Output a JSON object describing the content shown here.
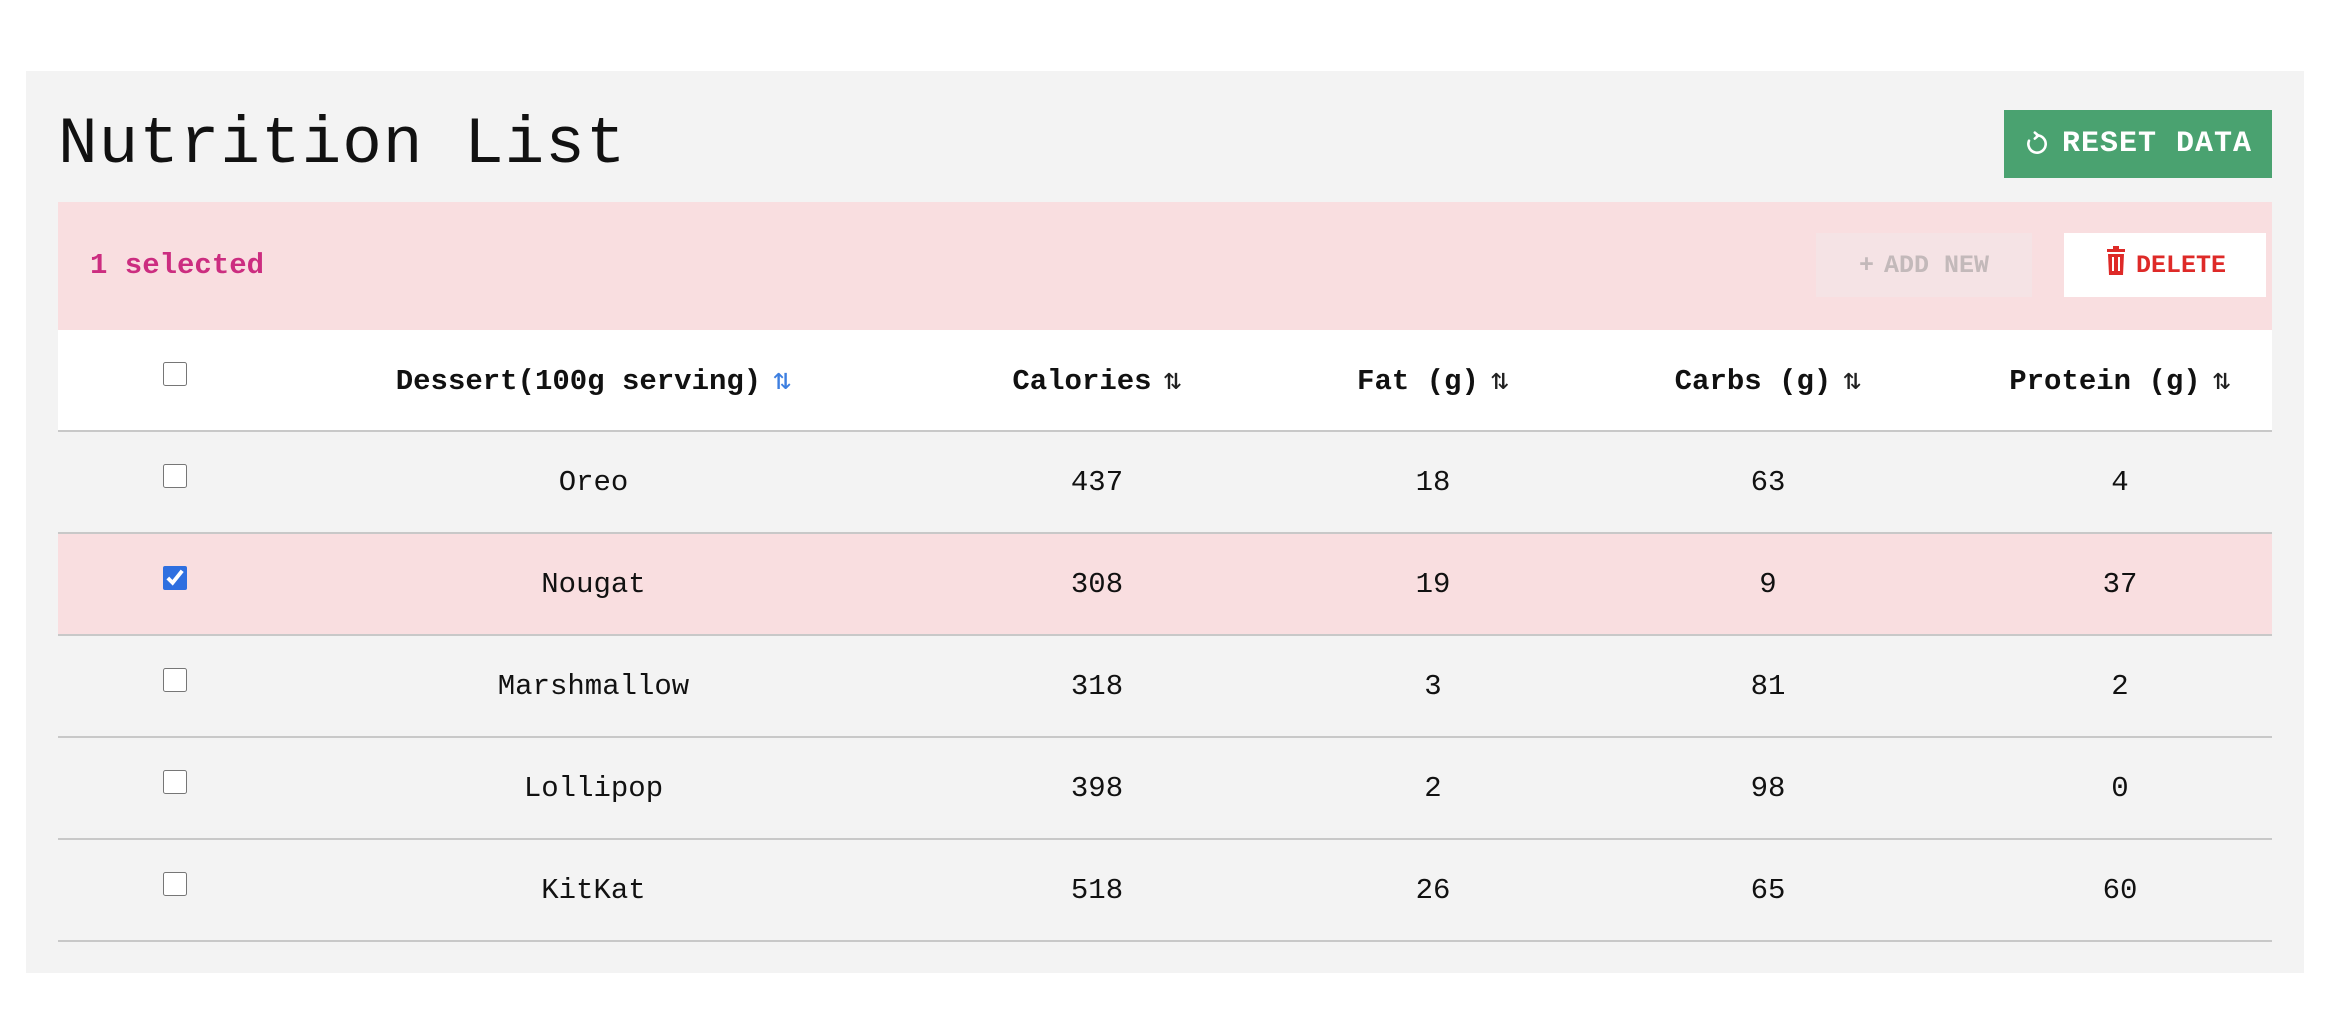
{
  "page": {
    "title": "Nutrition List"
  },
  "toolbar": {
    "reset_label": "RESET DATA",
    "reset_icon": "refresh-icon",
    "selected_count_text": "1 selected",
    "add_label": "ADD NEW",
    "add_icon": "plus-icon",
    "delete_label": "DELETE",
    "delete_icon": "trash-icon"
  },
  "colors": {
    "reset_button": "#4aa270",
    "selection_bar": "#f9dee0",
    "selected_text": "#cc2d80",
    "delete_text": "#de2a28",
    "active_sort": "#3d7fe0"
  },
  "table": {
    "columns": [
      {
        "label": "Dessert(100g serving)",
        "sort_icon": "sort-arrows-icon",
        "active": true
      },
      {
        "label": "Calories",
        "sort_icon": "sort-arrows-icon",
        "active": false
      },
      {
        "label": "Fat (g)",
        "sort_icon": "sort-arrows-icon",
        "active": false
      },
      {
        "label": "Carbs (g)",
        "sort_icon": "sort-arrows-icon",
        "active": false
      },
      {
        "label": "Protein (g)",
        "sort_icon": "sort-arrows-icon",
        "active": false
      }
    ],
    "header_checkbox_checked": false,
    "rows": [
      {
        "checked": false,
        "dessert": "Oreo",
        "calories": "437",
        "fat": "18",
        "carbs": "63",
        "protein": "4"
      },
      {
        "checked": true,
        "dessert": "Nougat",
        "calories": "308",
        "fat": "19",
        "carbs": "9",
        "protein": "37"
      },
      {
        "checked": false,
        "dessert": "Marshmallow",
        "calories": "318",
        "fat": "3",
        "carbs": "81",
        "protein": "2"
      },
      {
        "checked": false,
        "dessert": "Lollipop",
        "calories": "398",
        "fat": "2",
        "carbs": "98",
        "protein": "0"
      },
      {
        "checked": false,
        "dessert": "KitKat",
        "calories": "518",
        "fat": "26",
        "carbs": "65",
        "protein": "60"
      }
    ]
  }
}
